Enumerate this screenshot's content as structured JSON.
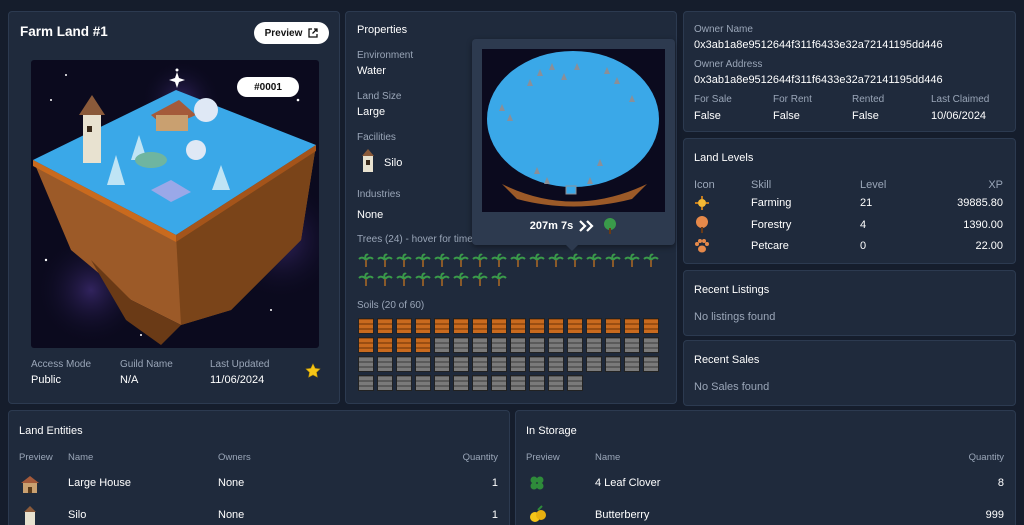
{
  "land": {
    "title": "Farm Land #1",
    "preview_label": "Preview",
    "badge": "#0001",
    "access_mode_label": "Access Mode",
    "access_mode": "Public",
    "guild_name_label": "Guild Name",
    "guild_name": "N/A",
    "last_updated_label": "Last Updated",
    "last_updated": "11/06/2024"
  },
  "properties": {
    "title": "Properties",
    "environment_label": "Environment",
    "environment": "Water",
    "land_size_label": "Land Size",
    "land_size": "Large",
    "facilities_label": "Facilities",
    "facility": "Silo",
    "industries_label": "Industries",
    "industries": "None",
    "trees_label": "Trees (24) - hover for time",
    "tree_count": 24,
    "soils_label": "Soils (20 of 60)",
    "soils_filled": 20,
    "soils_total": 60,
    "tooltip_time": "207m 7s"
  },
  "owner": {
    "owner_name_label": "Owner Name",
    "owner_name": "0x3ab1a8e9512644f311f6433e32a72141195dd446",
    "owner_address_label": "Owner Address",
    "owner_address": "0x3ab1a8e9512644f311f6433e32a72141195dd446",
    "for_sale_label": "For Sale",
    "for_sale": "False",
    "for_rent_label": "For Rent",
    "for_rent": "False",
    "rented_label": "Rented",
    "rented": "False",
    "last_claimed_label": "Last Claimed",
    "last_claimed": "10/06/2024"
  },
  "levels": {
    "title": "Land Levels",
    "headers": {
      "icon": "Icon",
      "skill": "Skill",
      "level": "Level",
      "xp": "XP"
    },
    "rows": [
      {
        "skill": "Farming",
        "level": "21",
        "xp": "39885.80",
        "icon": "farming-icon"
      },
      {
        "skill": "Forestry",
        "level": "4",
        "xp": "1390.00",
        "icon": "forestry-icon"
      },
      {
        "skill": "Petcare",
        "level": "0",
        "xp": "22.00",
        "icon": "petcare-icon"
      }
    ]
  },
  "listings": {
    "title": "Recent Listings",
    "empty": "No listings found"
  },
  "sales": {
    "title": "Recent Sales",
    "empty": "No Sales found"
  },
  "entities": {
    "title": "Land Entities",
    "headers": {
      "preview": "Preview",
      "name": "Name",
      "owners": "Owners",
      "quantity": "Quantity"
    },
    "rows": [
      {
        "name": "Large House",
        "owners": "None",
        "quantity": "1"
      },
      {
        "name": "Silo",
        "owners": "None",
        "quantity": "1"
      }
    ]
  },
  "storage": {
    "title": "In Storage",
    "headers": {
      "preview": "Preview",
      "name": "Name",
      "quantity": "Quantity"
    },
    "rows": [
      {
        "name": "4 Leaf Clover",
        "quantity": "8"
      },
      {
        "name": "Butterberry",
        "quantity": "999"
      }
    ]
  },
  "colors": {
    "background": "#151d2c",
    "panel": "#1f2a3c",
    "label": "#9aa6b8",
    "water": "#3aa8e8",
    "soil_filled": "#c96a1e",
    "soil_empty": "#7a7a7a",
    "star": "#f5c518"
  }
}
